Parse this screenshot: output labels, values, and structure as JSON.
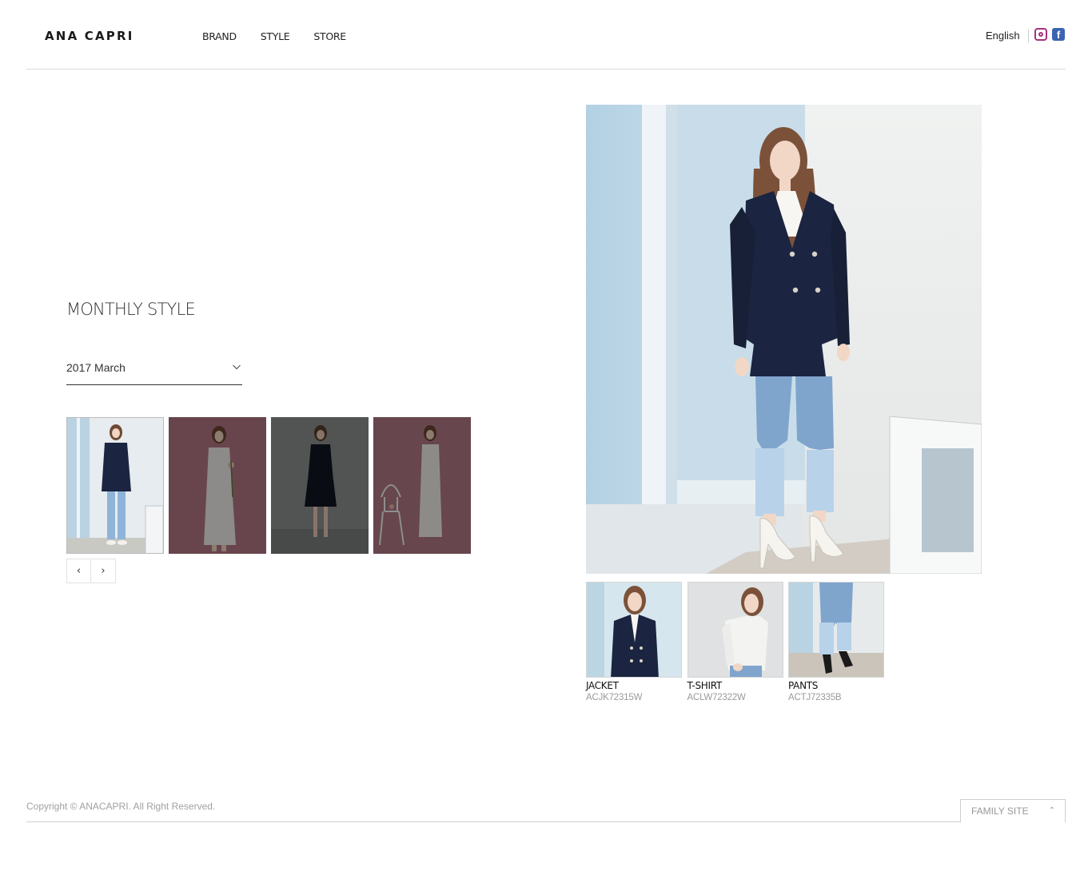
{
  "header": {
    "logo": "ANA CAPRI",
    "nav": [
      "BRAND",
      "STYLE",
      "STORE"
    ],
    "language": "English"
  },
  "section": {
    "title": "MONTHLY STYLE",
    "month_selected": "2017 March"
  },
  "pager": {
    "prev": "‹",
    "next": "›"
  },
  "items": [
    {
      "name": "JACKET",
      "code": "ACJK72315W"
    },
    {
      "name": "T-SHIRT",
      "code": "ACLW72322W"
    },
    {
      "name": "PANTS",
      "code": "ACTJ72335B"
    }
  ],
  "footer": {
    "copyright": "Copyright © ANACAPRI. All Right Reserved.",
    "family_site": "FAMILY SITE"
  },
  "colors": {
    "instagram": "#a6307e",
    "facebook": "#3b63b3",
    "jacket_navy": "#1b2440",
    "jeans": "#8fb4d8",
    "pink_backdrop": "#b37785",
    "grey_backdrop": "#8d9090"
  }
}
